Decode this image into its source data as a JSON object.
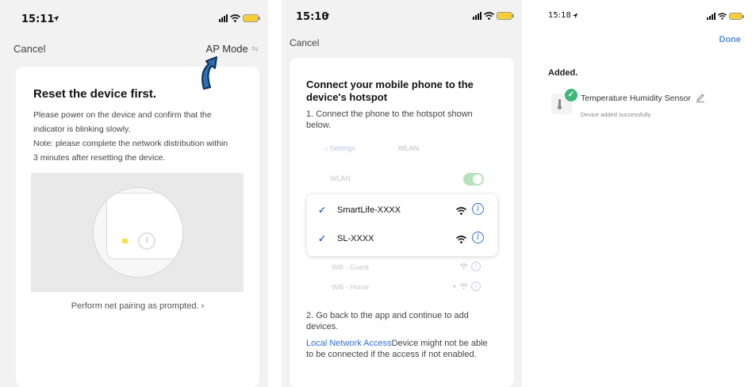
{
  "screen1": {
    "status": {
      "time": "15:11"
    },
    "nav": {
      "cancel": "Cancel",
      "ap_mode": "AP Mode"
    },
    "title": "Reset the device first.",
    "desc_lines": [
      "Please power on the device and confirm that the",
      "indicator is blinking slowly.",
      "Note: please complete the network distribution within",
      "3 minutes after resetting the device."
    ],
    "prompt": "Perform net pairing as prompted. ›"
  },
  "screen2": {
    "status": {
      "time": "15:10"
    },
    "nav": {
      "cancel": "Cancel"
    },
    "title": "Connect your mobile phone to the device's hotspot",
    "step1": "1. Connect the phone to the hotspot shown below.",
    "ios": {
      "back": "‹ Settings",
      "title": "WLAN",
      "wlan_label": "WLAN",
      "networks": [
        "SmartLife-XXXX",
        "SL-XXXX"
      ],
      "other_networks": [
        "Wifi - Guest",
        "Wifi - Home"
      ]
    },
    "step2": "2. Go back to the app and continue to add devices.",
    "note_link": "Local Network Access",
    "note_text": "Device might not be able to be connected if the access if not enabled."
  },
  "screen3": {
    "status": {
      "time": "15:18"
    },
    "done": "Done",
    "added": "Added.",
    "device_name": "Temperature Humidity Sensor",
    "device_status": "Device added successfully"
  },
  "icons": {
    "navigation": "navigation-arrow-icon",
    "signal": "signal-bars-icon",
    "wifi": "wifi-icon",
    "battery": "battery-charging-icon",
    "info": "info-icon",
    "check": "checkmark-icon",
    "pencil": "pencil-icon",
    "pointer": "curved-arrow-icon"
  },
  "colors": {
    "accent_blue": "#2f6fd6",
    "done_blue": "#5b8fd8",
    "success_green": "#3cb878",
    "battery_yellow": "#f4d03f"
  }
}
